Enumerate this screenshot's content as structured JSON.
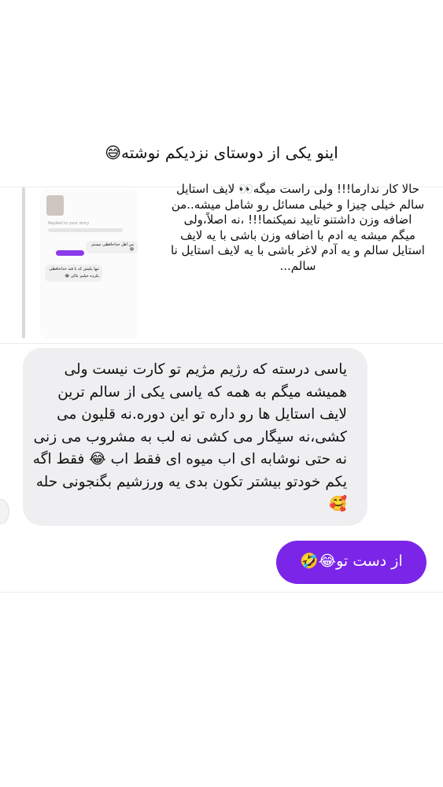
{
  "caption": "اینو یکی از دوستای نزدیکم نوشته😅",
  "story_reply": {
    "text": "حالا کار ندارما!!! ولی راست میگه👀 لایف استایل سالم خیلی چیزا و خیلی مسائل رو شامل میشه..من اضافه وزن داشتنو تایید نمیکنما!!! ،نه اصلاً،ولی میگم میشه یه ادم  با اضافه وزن باشی با یه لایف استایل سالم و یه آدم لاغر باشی با یه لایف استایل نا سالم...",
    "thumbnail": {
      "header": "Replied to your story",
      "bubble_right": "من اهل خداحافظی نیستم😅",
      "bubble_left": "تنها یکیش که با قند خداحافظی نکرده خیلیم عالی 😂"
    }
  },
  "messages": [
    {
      "direction": "incoming",
      "text": "یاسی درسته که رژیم مژیم تو کارت نیست ولی همیشه میگم به همه که یاسی یکی از سالم ترین لایف استایل ها رو داره تو این دوره.نه قلیون می کشی،نه سیگار می کشی نه لب به مشروب می زنی نه حتی نوشابه ای اب میوه ای فقط اب 😂 فقط اگه یکم خودتو بیشتر تکون بدی یه ورزشیم بگنجونی حله🥰"
    },
    {
      "direction": "outgoing",
      "text": "از دست تو😂🤣"
    }
  ],
  "colors": {
    "outgoing_bubble": "#7a25e8",
    "incoming_bubble": "#efeff1",
    "background": "#ffffff"
  }
}
